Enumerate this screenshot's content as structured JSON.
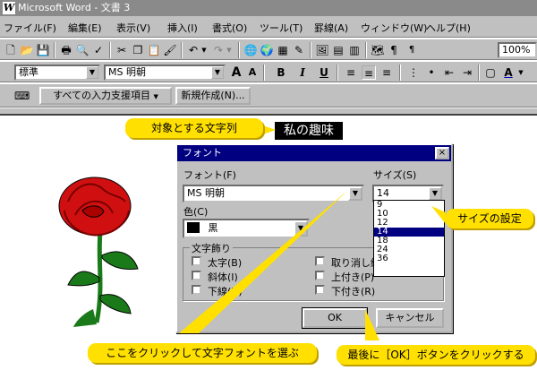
{
  "window": {
    "title": "Microsoft Word - 文書 3",
    "logo": "W"
  },
  "menu": [
    "ファイル(F)",
    "編集(E)",
    "表示(V)",
    "挿入(I)",
    "書式(O)",
    "ツール(T)",
    "罫線(A)",
    "ウィンドウ(W)",
    "ヘルプ(H)"
  ],
  "toolbar": {
    "zoom": "100%"
  },
  "format_bar": {
    "style": "標準",
    "font": "MS 明朝"
  },
  "ime_bar": {
    "assist": "すべての入力支援項目",
    "new": "新規作成(N)..."
  },
  "document": {
    "selected_text": "私の趣味"
  },
  "dialog": {
    "title": "フォント",
    "font_label": "フォント(F)",
    "font_value": "MS 明朝",
    "size_label": "サイズ(S)",
    "size_value": "14",
    "size_options": [
      "9",
      "10",
      "12",
      "14",
      "18",
      "24",
      "36"
    ],
    "size_selected_index": 3,
    "color_label": "色(C)",
    "color_value": "黒",
    "effects_label": "文字飾り",
    "effects": [
      "太字(B)",
      "斜体(I)",
      "下線(U)",
      "取り消し線",
      "上付き(P)",
      "下付き(R)"
    ],
    "ok": "OK",
    "cancel": "キャンセル",
    "close": "×"
  },
  "callouts": {
    "target": "対象とする文字列",
    "size": "サイズの設定",
    "font": "ここをクリックして文字フォントを選ぶ",
    "ok": "最後に［OK］ボタンをクリックする"
  },
  "colors": {
    "callout": "#ffe000",
    "dialog_title": "#000080",
    "rose": "#d01010",
    "stem": "#1a7a1a"
  }
}
